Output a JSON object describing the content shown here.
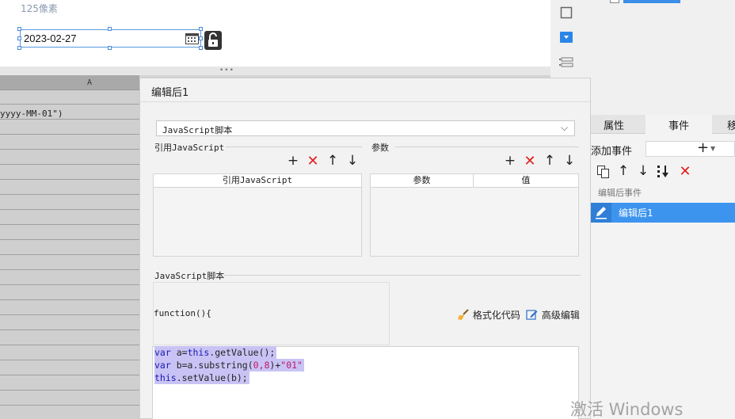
{
  "canvas": {
    "size_hint": "125像素",
    "date_value": "2023-02-27"
  },
  "sheet": {
    "column_a": "A",
    "cell_formula": "yyyy-MM-01\")"
  },
  "dialog": {
    "title": "编辑后1",
    "script_type": "JavaScript脚本",
    "ref_js_legend": "引用JavaScript",
    "params_legend": "参数",
    "ref_js_column": "引用JavaScript",
    "param_column": "参数",
    "value_column": "值",
    "script_legend": "JavaScript脚本",
    "function_header": "function(){",
    "format_code": "格式化代码",
    "advanced_edit": "高级编辑",
    "code": {
      "line1_kw": "var",
      "line1_rest_a": " a=",
      "line1_kw2": "this",
      "line1_rest_b": ".getValue();",
      "line2_kw": "var",
      "line2_rest_a": " b=a.substring(",
      "line2_num": "0,8",
      "line2_rest_b": ")+",
      "line2_str": "\"01\"",
      "line3_kw": "this",
      "line3_rest": ".setValue(b);"
    }
  },
  "right_panel": {
    "tabs": [
      "属性",
      "事件",
      "移"
    ],
    "add_event_label": "添加事件",
    "events_group": "编辑后事件",
    "event_item": "编辑后1"
  },
  "watermark": "激活 Windows",
  "colors": {
    "accent": "#3d94ef",
    "delete": "#e02020",
    "code_highlight": "#c9c3f5"
  }
}
